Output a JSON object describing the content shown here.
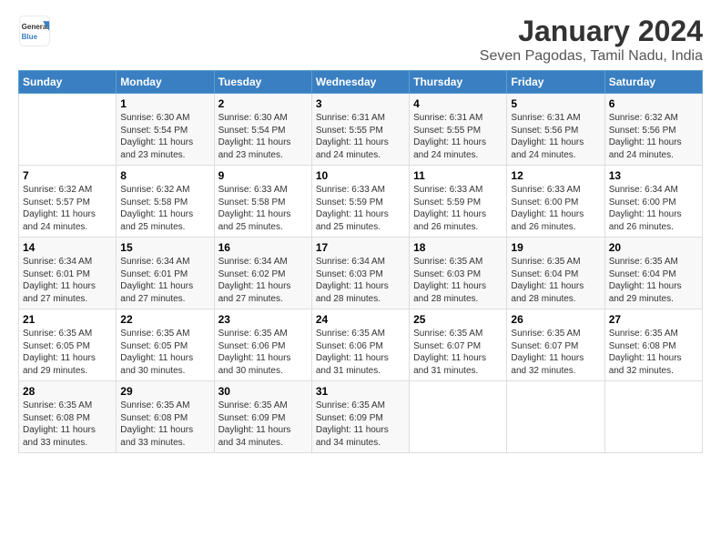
{
  "header": {
    "logo_general": "General",
    "logo_blue": "Blue",
    "title": "January 2024",
    "subtitle": "Seven Pagodas, Tamil Nadu, India"
  },
  "weekdays": [
    "Sunday",
    "Monday",
    "Tuesday",
    "Wednesday",
    "Thursday",
    "Friday",
    "Saturday"
  ],
  "weeks": [
    [
      {
        "day": "",
        "info": ""
      },
      {
        "day": "1",
        "info": "Sunrise: 6:30 AM\nSunset: 5:54 PM\nDaylight: 11 hours\nand 23 minutes."
      },
      {
        "day": "2",
        "info": "Sunrise: 6:30 AM\nSunset: 5:54 PM\nDaylight: 11 hours\nand 23 minutes."
      },
      {
        "day": "3",
        "info": "Sunrise: 6:31 AM\nSunset: 5:55 PM\nDaylight: 11 hours\nand 24 minutes."
      },
      {
        "day": "4",
        "info": "Sunrise: 6:31 AM\nSunset: 5:55 PM\nDaylight: 11 hours\nand 24 minutes."
      },
      {
        "day": "5",
        "info": "Sunrise: 6:31 AM\nSunset: 5:56 PM\nDaylight: 11 hours\nand 24 minutes."
      },
      {
        "day": "6",
        "info": "Sunrise: 6:32 AM\nSunset: 5:56 PM\nDaylight: 11 hours\nand 24 minutes."
      }
    ],
    [
      {
        "day": "7",
        "info": "Sunrise: 6:32 AM\nSunset: 5:57 PM\nDaylight: 11 hours\nand 24 minutes."
      },
      {
        "day": "8",
        "info": "Sunrise: 6:32 AM\nSunset: 5:58 PM\nDaylight: 11 hours\nand 25 minutes."
      },
      {
        "day": "9",
        "info": "Sunrise: 6:33 AM\nSunset: 5:58 PM\nDaylight: 11 hours\nand 25 minutes."
      },
      {
        "day": "10",
        "info": "Sunrise: 6:33 AM\nSunset: 5:59 PM\nDaylight: 11 hours\nand 25 minutes."
      },
      {
        "day": "11",
        "info": "Sunrise: 6:33 AM\nSunset: 5:59 PM\nDaylight: 11 hours\nand 26 minutes."
      },
      {
        "day": "12",
        "info": "Sunrise: 6:33 AM\nSunset: 6:00 PM\nDaylight: 11 hours\nand 26 minutes."
      },
      {
        "day": "13",
        "info": "Sunrise: 6:34 AM\nSunset: 6:00 PM\nDaylight: 11 hours\nand 26 minutes."
      }
    ],
    [
      {
        "day": "14",
        "info": "Sunrise: 6:34 AM\nSunset: 6:01 PM\nDaylight: 11 hours\nand 27 minutes."
      },
      {
        "day": "15",
        "info": "Sunrise: 6:34 AM\nSunset: 6:01 PM\nDaylight: 11 hours\nand 27 minutes."
      },
      {
        "day": "16",
        "info": "Sunrise: 6:34 AM\nSunset: 6:02 PM\nDaylight: 11 hours\nand 27 minutes."
      },
      {
        "day": "17",
        "info": "Sunrise: 6:34 AM\nSunset: 6:03 PM\nDaylight: 11 hours\nand 28 minutes."
      },
      {
        "day": "18",
        "info": "Sunrise: 6:35 AM\nSunset: 6:03 PM\nDaylight: 11 hours\nand 28 minutes."
      },
      {
        "day": "19",
        "info": "Sunrise: 6:35 AM\nSunset: 6:04 PM\nDaylight: 11 hours\nand 28 minutes."
      },
      {
        "day": "20",
        "info": "Sunrise: 6:35 AM\nSunset: 6:04 PM\nDaylight: 11 hours\nand 29 minutes."
      }
    ],
    [
      {
        "day": "21",
        "info": "Sunrise: 6:35 AM\nSunset: 6:05 PM\nDaylight: 11 hours\nand 29 minutes."
      },
      {
        "day": "22",
        "info": "Sunrise: 6:35 AM\nSunset: 6:05 PM\nDaylight: 11 hours\nand 30 minutes."
      },
      {
        "day": "23",
        "info": "Sunrise: 6:35 AM\nSunset: 6:06 PM\nDaylight: 11 hours\nand 30 minutes."
      },
      {
        "day": "24",
        "info": "Sunrise: 6:35 AM\nSunset: 6:06 PM\nDaylight: 11 hours\nand 31 minutes."
      },
      {
        "day": "25",
        "info": "Sunrise: 6:35 AM\nSunset: 6:07 PM\nDaylight: 11 hours\nand 31 minutes."
      },
      {
        "day": "26",
        "info": "Sunrise: 6:35 AM\nSunset: 6:07 PM\nDaylight: 11 hours\nand 32 minutes."
      },
      {
        "day": "27",
        "info": "Sunrise: 6:35 AM\nSunset: 6:08 PM\nDaylight: 11 hours\nand 32 minutes."
      }
    ],
    [
      {
        "day": "28",
        "info": "Sunrise: 6:35 AM\nSunset: 6:08 PM\nDaylight: 11 hours\nand 33 minutes."
      },
      {
        "day": "29",
        "info": "Sunrise: 6:35 AM\nSunset: 6:08 PM\nDaylight: 11 hours\nand 33 minutes."
      },
      {
        "day": "30",
        "info": "Sunrise: 6:35 AM\nSunset: 6:09 PM\nDaylight: 11 hours\nand 34 minutes."
      },
      {
        "day": "31",
        "info": "Sunrise: 6:35 AM\nSunset: 6:09 PM\nDaylight: 11 hours\nand 34 minutes."
      },
      {
        "day": "",
        "info": ""
      },
      {
        "day": "",
        "info": ""
      },
      {
        "day": "",
        "info": ""
      }
    ]
  ]
}
